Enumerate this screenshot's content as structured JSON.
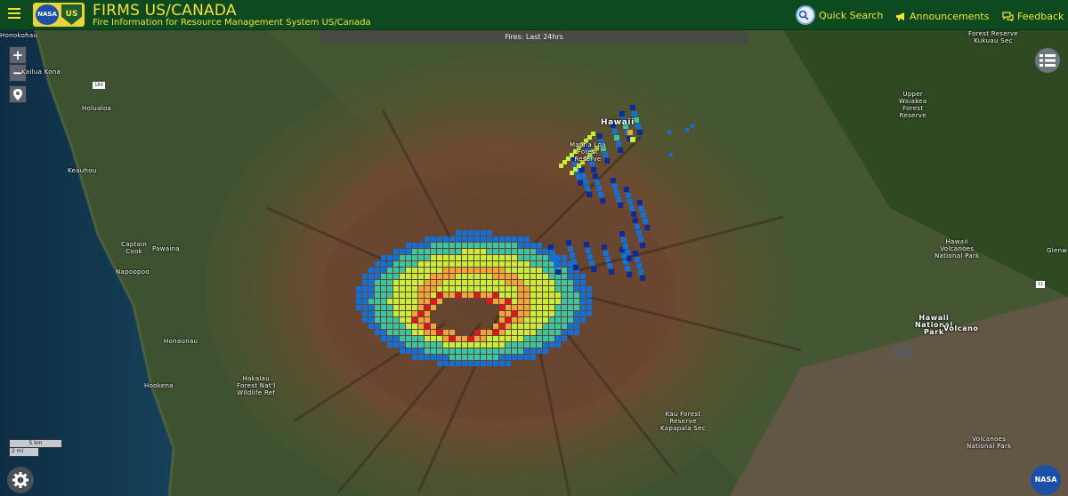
{
  "header": {
    "title": "FIRMS US/CANADA",
    "subtitle": "Fire Information for Resource Management System US/Canada",
    "nav": {
      "quick_search": "Quick Search",
      "announcements": "Announcements",
      "feedback": "Feedback"
    },
    "logos": {
      "nasa": "NASA",
      "usfs": "US"
    },
    "colors": {
      "bar": "#0e4a1f",
      "accent": "#f4e23a"
    }
  },
  "banner": {
    "text": "Fires: Last 24hrs"
  },
  "map": {
    "controls": {
      "zoom_in": "+",
      "zoom_out": "−"
    },
    "scale": {
      "km": "5 km",
      "mi": "2 mi"
    },
    "shields": {
      "hwy": "180",
      "rt11": "11"
    },
    "nasa_badge": "NASA",
    "labels": [
      {
        "id": "honokohau",
        "text": "Honokohau"
      },
      {
        "id": "kailua-kona",
        "text": "Kailua Kona"
      },
      {
        "id": "holualoa",
        "text": "Holualoa"
      },
      {
        "id": "kealahou",
        "text": "Keauhou"
      },
      {
        "id": "captain-cook",
        "text": "Captain\nCook"
      },
      {
        "id": "pawaina",
        "text": "Pawaina"
      },
      {
        "id": "napoopoo",
        "text": "Napoopoo"
      },
      {
        "id": "honaunau",
        "text": "Honaunau"
      },
      {
        "id": "hookena",
        "text": "Hookena"
      },
      {
        "id": "hakalau",
        "text": "Hakalau\nForest Nat'l\nWildlife Ref"
      },
      {
        "id": "hawaii-top",
        "text": "Hawaii"
      },
      {
        "id": "mauna-loa",
        "text": "Mauna Loa\nForest\nReserve"
      },
      {
        "id": "upper-waiakea",
        "text": "Upper\nWaiakea\nForest\nReserve"
      },
      {
        "id": "kukuau",
        "text": "Forest Reserve\nKukuau Sec"
      },
      {
        "id": "hvnp",
        "text": "Hawaii\nVolcanoes\nNational Park"
      },
      {
        "id": "glenwood",
        "text": "Glenw"
      },
      {
        "id": "hawaii-np",
        "text": "Hawaii\nNational\nPark"
      },
      {
        "id": "volcano",
        "text": "Volcano"
      },
      {
        "id": "kau",
        "text": "Kau Forest\nReserve\nKapapala Sec"
      },
      {
        "id": "volcanoes-bottom",
        "text": "Volcanoes\nNational Park"
      }
    ],
    "legend_colors": {
      "hot": "#e8121e",
      "warm": "#f2a33a",
      "mid": "#c8ee3c",
      "cool": "#38c6a4",
      "cold": "#1270d8",
      "coldest": "#0a2b9c"
    }
  }
}
